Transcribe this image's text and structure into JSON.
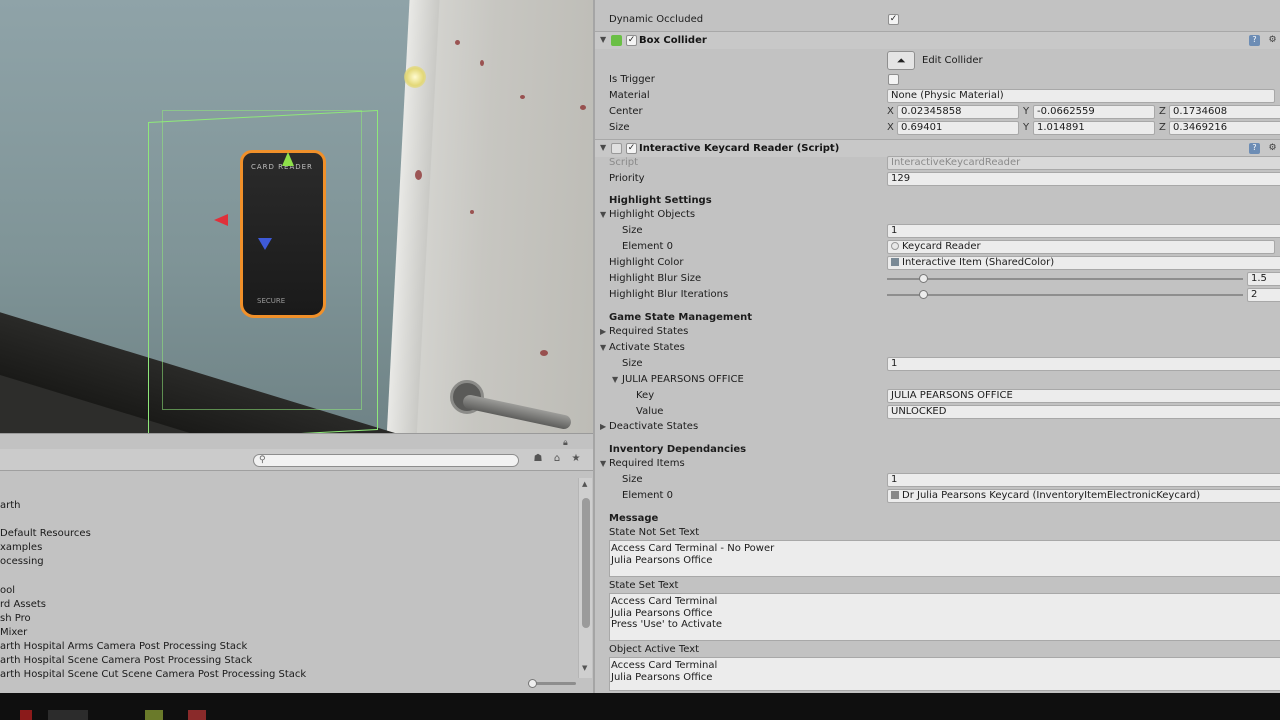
{
  "scene": {
    "keycard_label": "CARD READER",
    "keycard_footer": "SECURE"
  },
  "project": {
    "search_placeholder": "",
    "items": [
      "arth",
      "Default Resources",
      "xamples",
      "ocessing",
      "ool",
      "rd Assets",
      "sh Pro",
      "Mixer",
      "arth Hospital Arms Camera Post Processing Stack",
      "arth Hospital Scene Camera Post Processing Stack",
      "arth Hospital Scene Cut Scene Camera Post Processing Stack"
    ]
  },
  "inspector": {
    "dynamic_occluded": {
      "label": "Dynamic Occluded",
      "checked": "✓"
    },
    "box_collider": {
      "title": "Box Collider",
      "enabled": "✓",
      "edit_collider_label": "Edit Collider",
      "edit_collider_icon": "edit-bounds-icon",
      "is_trigger_label": "Is Trigger",
      "material_label": "Material",
      "material_value": "None (Physic Material)",
      "center_label": "Center",
      "center": {
        "x": "0.02345858",
        "y": "-0.0662559",
        "z": "0.1734608"
      },
      "size_label": "Size",
      "size": {
        "x": "0.69401",
        "y": "1.014891",
        "z": "0.3469216"
      }
    },
    "keycard_script": {
      "title": "Interactive Keycard Reader (Script)",
      "enabled": "✓",
      "script_label": "Script",
      "script_value": "InteractiveKeycardReader",
      "priority_label": "Priority",
      "priority_value": "129",
      "highlight_settings": "Highlight Settings",
      "highlight_objects": "Highlight Objects",
      "ho_size_label": "Size",
      "ho_size_value": "1",
      "element0_label": "Element 0",
      "element0_value": "Keycard Reader",
      "highlight_color_label": "Highlight Color",
      "highlight_color_value": "Interactive Item (SharedColor)",
      "blur_size_label": "Highlight Blur Size",
      "blur_size_value": "1.5",
      "blur_size_level": 0.1,
      "blur_iter_label": "Highlight Blur Iterations",
      "blur_iter_value": "2",
      "blur_iter_level": 0.1,
      "game_state_mgmt": "Game State Management",
      "required_states": "Required States",
      "activate_states": "Activate States",
      "as_size_label": "Size",
      "as_size_value": "1",
      "office_group": "JULIA PEARSONS OFFICE",
      "key_label": "Key",
      "key_value": "JULIA PEARSONS OFFICE",
      "value_label": "Value",
      "value_value": "UNLOCKED",
      "deactivate_states": "Deactivate States",
      "inventory_deps": "Inventory Dependancies",
      "required_items": "Required Items",
      "ri_size_label": "Size",
      "ri_size_value": "1",
      "ri_element0_label": "Element 0",
      "ri_element0_value": "Dr Julia Pearsons Keycard (InventoryItemElectronicKeycard)",
      "message": "Message",
      "state_not_set_label": "State Not Set Text",
      "state_not_set_text": "Access Card Terminal - No Power\nJulia Pearsons Office",
      "state_set_label": "State Set Text",
      "state_set_text": "Access Card Terminal\nJulia Pearsons Office\nPress 'Use' to Activate",
      "object_active_label": "Object Active Text",
      "object_active_text": "Access Card Terminal\nJulia Pearsons Office"
    }
  },
  "colors": {
    "panel_bg": "#c2c2c2",
    "field_bg": "#ececec",
    "bbox_green": "#8fe87a",
    "selection_orange": "#f0902a"
  }
}
